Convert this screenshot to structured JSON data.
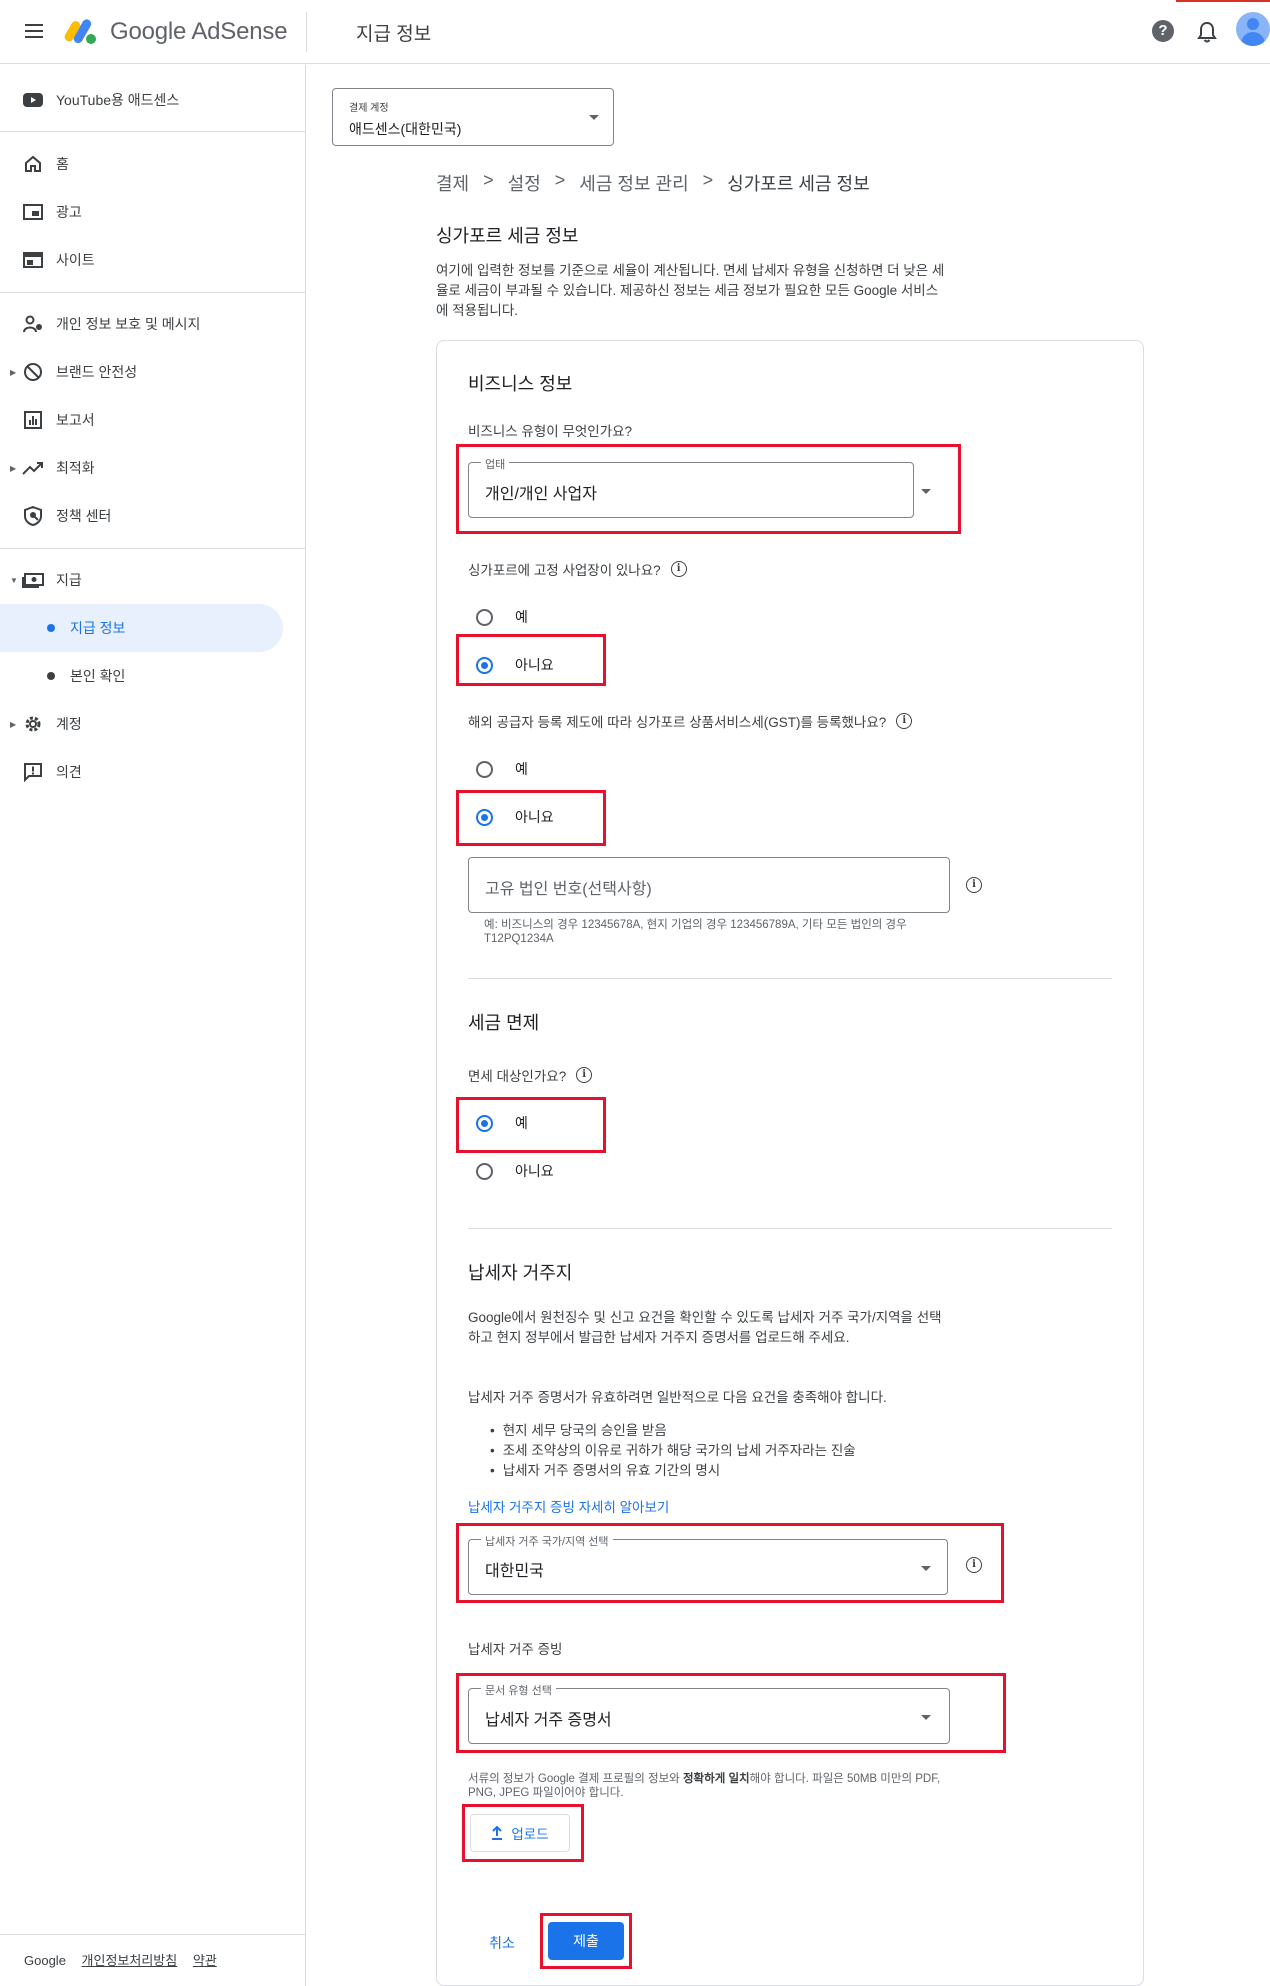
{
  "header": {
    "product_name": "Google AdSense",
    "page_title": "지급 정보"
  },
  "sidebar": {
    "items": [
      {
        "label": "YouTube용 애드센스",
        "icon": "youtube-icon"
      },
      {
        "label": "홈",
        "icon": "home-icon"
      },
      {
        "label": "광고",
        "icon": "ads-icon"
      },
      {
        "label": "사이트",
        "icon": "sites-icon"
      },
      {
        "label": "개인 정보 보호 및 메시지",
        "icon": "privacy-icon"
      },
      {
        "label": "브랜드 안전성",
        "icon": "block-icon"
      },
      {
        "label": "보고서",
        "icon": "reports-icon"
      },
      {
        "label": "최적화",
        "icon": "trending-icon"
      },
      {
        "label": "정책 센터",
        "icon": "shield-icon"
      },
      {
        "label": "지급",
        "icon": "payments-icon"
      },
      {
        "label": "지급 정보",
        "icon": "dot-icon"
      },
      {
        "label": "본인 확인",
        "icon": "dot-icon"
      },
      {
        "label": "계정",
        "icon": "gear-icon"
      },
      {
        "label": "의견",
        "icon": "feedback-icon"
      }
    ],
    "footer": {
      "brand": "Google",
      "privacy": "개인정보처리방침",
      "terms": "약관"
    }
  },
  "account_select": {
    "label": "결제 계정",
    "value": "애드센스(대한민국)"
  },
  "breadcrumb": [
    "결제",
    "설정",
    "세금 정보 관리",
    "싱가포르 세금 정보"
  ],
  "breadcrumb_separator": ">",
  "section": {
    "title": "싱가포르 세금 정보",
    "intro": "여기에 입력한 정보를 기준으로 세율이 계산됩니다. 면세 납세자 유형을 신청하면 더 낮은 세율로 세금이 부과될 수 있습니다. 제공하신 정보는 세금 정보가 필요한 모든 Google 서비스에 적용됩니다."
  },
  "business": {
    "heading": "비즈니스 정보",
    "type_question": "비즈니스 유형이 무엇인가요?",
    "type_label": "업태",
    "type_value": "개인/개인 사업자",
    "fixed_place_question": "싱가포르에 고정 사업장이 있나요?",
    "fixed_place_options": [
      "예",
      "아니요"
    ],
    "fixed_place_selected": "아니요",
    "gst_question": "해외 공급자 등록 제도에 따라 싱가포르 상품서비스세(GST)를 등록했나요?",
    "gst_options": [
      "예",
      "아니요"
    ],
    "gst_selected": "아니요",
    "uen_placeholder": "고유 법인 번호(선택사항)",
    "uen_hint": "예: 비즈니스의 경우 12345678A, 현지 기업의 경우 123456789A, 기타 모든 법인의 경우 T12PQ1234A"
  },
  "exemption": {
    "heading": "세금 면제",
    "question": "면세 대상인가요?",
    "options": [
      "예",
      "아니요"
    ],
    "selected": "예"
  },
  "residency": {
    "heading": "납세자 거주지",
    "desc": "Google에서 원천징수 및 신고 요건을 확인할 수 있도록 납세자 거주 국가/지역을 선택하고 현지 정부에서 발급한 납세자 거주지 증명서를 업로드해 주세요.",
    "requirements_intro": "납세자 거주 증명서가 유효하려면 일반적으로 다음 요건을 충족해야 합니다.",
    "requirements": [
      "현지 세무 당국의 승인을 받음",
      "조세 조약상의 이유로 귀하가 해당 국가의 납세 거주자라는 진술",
      "납세자 거주 증명서의 유효 기간의 명시"
    ],
    "learn_more": "납세자 거주지 증빙 자세히 알아보기",
    "country_label": "납세자 거주 국가/지역 선택",
    "country_value": "대한민국",
    "proof_heading": "납세자 거주 증빙",
    "doc_label": "문서 유형 선택",
    "doc_value": "납세자 거주 증명서",
    "doc_hint_pre": "서류의 정보가 Google 결제 프로필의 정보와 ",
    "doc_hint_bold": "정확하게 일치",
    "doc_hint_post": "해야 합니다. 파일은 50MB 미만의 PDF, PNG, JPEG 파일이어야 합니다.",
    "upload_label": "업로드"
  },
  "actions": {
    "cancel": "취소",
    "submit": "제출"
  },
  "colors": {
    "accent": "#1a73e8",
    "highlight_box": "#e8112d",
    "active_nav_bg": "#e8f0fe"
  }
}
